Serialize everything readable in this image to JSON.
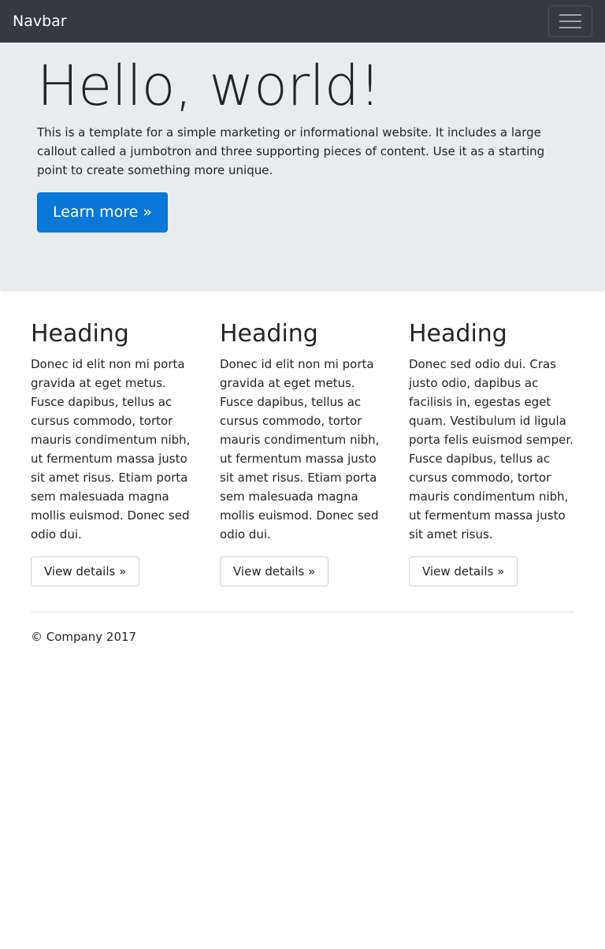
{
  "navbar": {
    "brand": "Navbar",
    "toggler_icon": "hamburger-icon"
  },
  "jumbotron": {
    "title": "Hello, world!",
    "lead": "This is a template for a simple marketing or informational website. It includes a large callout called a jumbotron and three supporting pieces of content. Use it as a starting point to create something more unique.",
    "button_label": "Learn more »"
  },
  "columns": [
    {
      "heading": "Heading",
      "text": "Donec id elit non mi porta gravida at eget metus. Fusce dapibus, tellus ac cursus commodo, tortor mauris condimentum nibh, ut fermentum massa justo sit amet risus. Etiam porta sem malesuada magna mollis euismod. Donec sed odio dui.",
      "button_label": "View details »"
    },
    {
      "heading": "Heading",
      "text": "Donec id elit non mi porta gravida at eget metus. Fusce dapibus, tellus ac cursus commodo, tortor mauris condimentum nibh, ut fermentum massa justo sit amet risus. Etiam porta sem malesuada magna mollis euismod. Donec sed odio dui.",
      "button_label": "View details »"
    },
    {
      "heading": "Heading",
      "text": "Donec sed odio dui. Cras justo odio, dapibus ac facilisis in, egestas eget quam. Vestibulum id ligula porta felis euismod semper. Fusce dapibus, tellus ac cursus commodo, tortor mauris condimentum nibh, ut fermentum massa justo sit amet risus.",
      "button_label": "View details »"
    }
  ],
  "footer": {
    "text": "© Company 2017"
  },
  "colors": {
    "navbar_bg": "#343a40",
    "jumbotron_bg": "#e9ecef",
    "primary": "#0a78d8",
    "text": "#212529"
  }
}
